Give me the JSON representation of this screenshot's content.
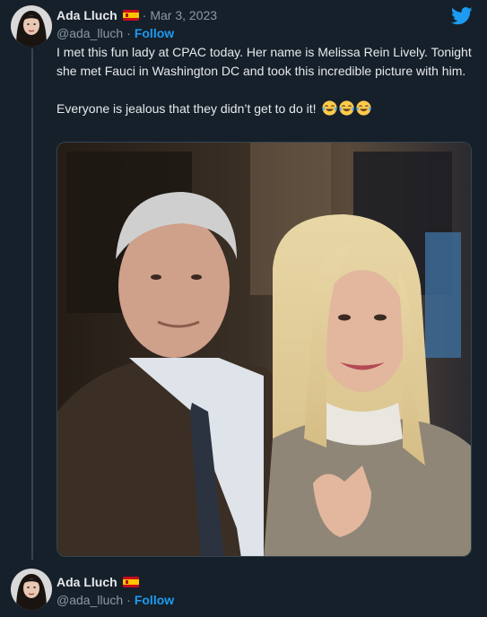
{
  "tweet": {
    "author": {
      "name": "Ada Lluch",
      "handle": "@ada_lluch",
      "flag_icon": "spain-flag-icon"
    },
    "date": "Mar 3, 2023",
    "separator": "·",
    "date_prefix": "·",
    "follow_label": "Follow",
    "paragraphs": [
      "I met this fun lady at CPAC today. Her name is Melissa Rein Lively. Tonight she met Fauci in Washington DC and took this incredible picture with him.",
      "Everyone is jealous that they didn’t get to do it!"
    ],
    "emojis": [
      "face-with-tears-of-joy-icon",
      "face-with-tears-of-joy-icon",
      "face-with-tears-of-joy-icon"
    ],
    "brand_icon": "twitter-bird-icon"
  },
  "reply": {
    "author": {
      "name": "Ada Lluch",
      "handle": "@ada_lluch"
    },
    "separator": "·",
    "follow_label": "Follow"
  },
  "colors": {
    "background": "#15202b",
    "text": "#e7e9ea",
    "secondary": "#8b98a5",
    "accent": "#1d9bf0"
  }
}
